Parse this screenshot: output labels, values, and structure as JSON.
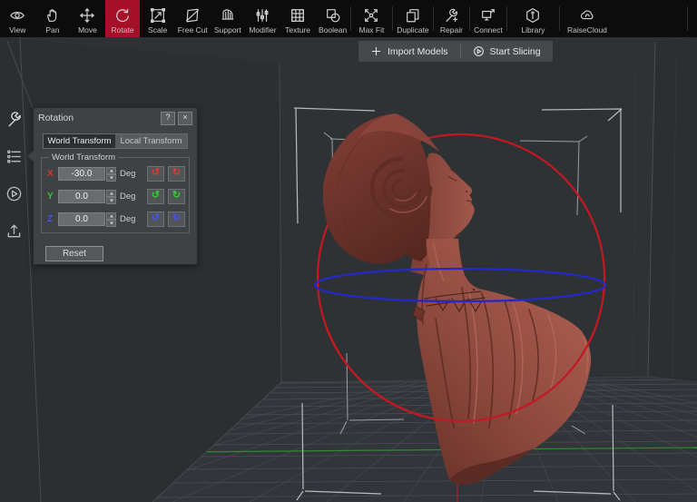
{
  "toolbar": {
    "active_color": "#a50f27",
    "items": [
      {
        "label": "View",
        "icon": "eye-icon",
        "active": false
      },
      {
        "label": "Pan",
        "icon": "hand-icon",
        "active": false
      },
      {
        "label": "Move",
        "icon": "move-icon",
        "active": false
      },
      {
        "label": "Rotate",
        "icon": "rotate-icon",
        "active": true
      },
      {
        "label": "Scale",
        "icon": "scale-icon",
        "active": false
      },
      {
        "label": "Free Cut",
        "icon": "free-cut-icon",
        "active": false
      },
      {
        "label": "Support",
        "icon": "support-icon",
        "active": false
      },
      {
        "label": "Modifier",
        "icon": "modifier-icon",
        "active": false
      },
      {
        "label": "Texture",
        "icon": "texture-icon",
        "active": false
      },
      {
        "label": "Boolean",
        "icon": "boolean-icon",
        "active": false
      },
      {
        "label": "Max Fit",
        "icon": "max-fit-icon",
        "active": false
      },
      {
        "label": "Duplicate",
        "icon": "duplicate-icon",
        "active": false
      },
      {
        "label": "Repair",
        "icon": "repair-icon",
        "active": false
      },
      {
        "label": "Connect",
        "icon": "connect-icon",
        "active": false
      },
      {
        "label": "Library",
        "icon": "library-icon",
        "active": false
      },
      {
        "label": "RaiseCloud",
        "icon": "cloud-icon",
        "active": false
      }
    ]
  },
  "actionbar": {
    "import_label": "Import Models",
    "slice_label": "Start Slicing"
  },
  "sidebar": {
    "items": [
      {
        "name": "transform-tools",
        "icon": "wrench-icon",
        "active": true
      },
      {
        "name": "model-list",
        "icon": "list-icon",
        "active": false
      },
      {
        "name": "print-preview",
        "icon": "play-circle-icon",
        "active": false
      },
      {
        "name": "export-upload",
        "icon": "upload-icon",
        "active": false
      }
    ]
  },
  "rotation_dialog": {
    "title": "Rotation",
    "help_label": "?",
    "close_label": "×",
    "tabs": [
      {
        "label": "World Transform",
        "active": true
      },
      {
        "label": "Local Transform",
        "active": false
      }
    ],
    "group_label": "World Transform",
    "rows": [
      {
        "axis": "X",
        "value": "-30.0",
        "unit": "Deg",
        "color": "#cf3a2c",
        "ccw": "↺",
        "cw": "↻"
      },
      {
        "axis": "Y",
        "value": "0.0",
        "unit": "Deg",
        "color": "#37c837",
        "ccw": "↺",
        "cw": "↻"
      },
      {
        "axis": "Z",
        "value": "0.0",
        "unit": "Deg",
        "color": "#4553ef",
        "ccw": "↺",
        "cw": "↻"
      }
    ],
    "reset_label": "Reset"
  },
  "viewport": {
    "model_name": "female-bust",
    "colors": {
      "background": "#2e3235",
      "model": "#9a5044",
      "gizmo_x_circle": "#c41822",
      "gizmo_z_ellipse": "#2428cc",
      "axis_green": "#2e8b2e"
    }
  }
}
